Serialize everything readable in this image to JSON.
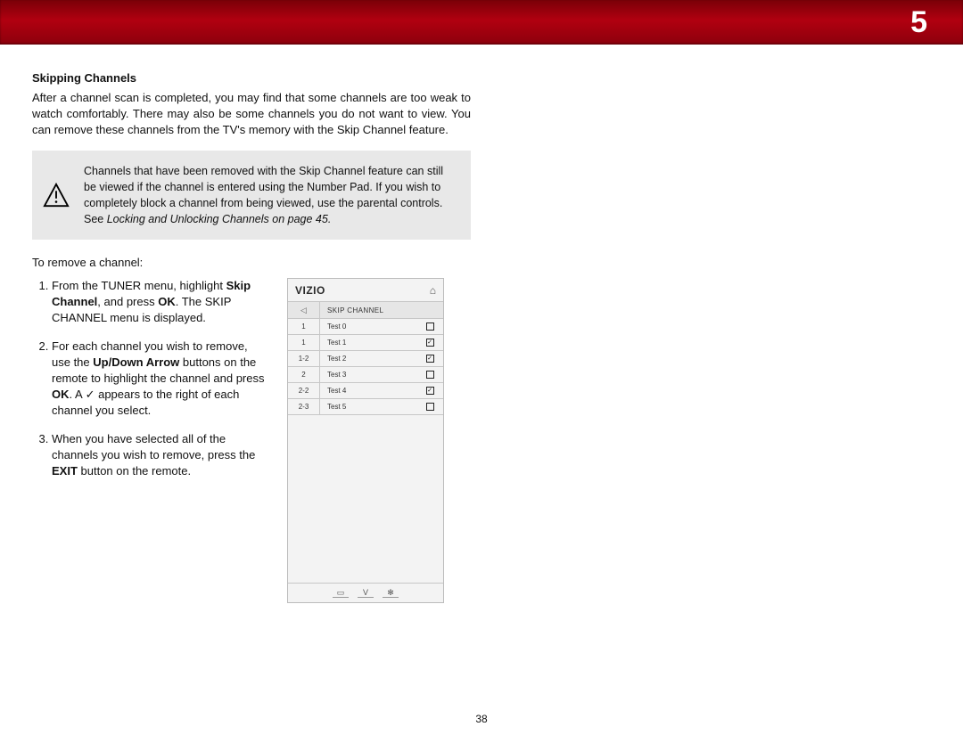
{
  "header": {
    "page_indicator": "5"
  },
  "section": {
    "title": "Skipping Channels",
    "lead": "After a channel scan is completed, you may find that some channels are too weak to watch comfortably. There may also be some channels you do not want to view. You can remove these channels from the TV's memory with the Skip Channel feature."
  },
  "note": {
    "text_before_link": "Channels that have been removed with the Skip Channel feature can still be viewed if the channel is entered using the Number Pad. If you wish to completely block a channel from being viewed, use the parental controls. See ",
    "link_text": "Locking and Unlocking Channels on page 45."
  },
  "intro": "To remove a channel:",
  "steps": {
    "s1_a": "From the TUNER menu, highlight ",
    "s1_b": "Skip Channel",
    "s1_c": ", and press ",
    "s1_d": "OK",
    "s1_e": ". The SKIP CHANNEL menu is displayed.",
    "s2_a": "For each channel you wish to remove, use the ",
    "s2_b": "Up/Down Arrow",
    "s2_c": " buttons on the remote to highlight the channel and press ",
    "s2_d": "OK",
    "s2_e": ". A ",
    "s2_check": "✓",
    "s2_f": " appears to the right of each channel you select.",
    "s3_a": "When you have selected all of the channels you wish to remove, press the ",
    "s3_b": "EXIT",
    "s3_c": " button on the remote."
  },
  "tv": {
    "logo": "VIZIO",
    "title": "SKIP CHANNEL",
    "rows": [
      {
        "num": "1",
        "name": "Test 0",
        "checked": false
      },
      {
        "num": "1",
        "name": "Test 1",
        "checked": true
      },
      {
        "num": "1-2",
        "name": "Test 2",
        "checked": true
      },
      {
        "num": "2",
        "name": "Test 3",
        "checked": false
      },
      {
        "num": "2-2",
        "name": "Test 4",
        "checked": true
      },
      {
        "num": "2-3",
        "name": "Test 5",
        "checked": false
      }
    ]
  },
  "footer": {
    "page_number": "38"
  }
}
